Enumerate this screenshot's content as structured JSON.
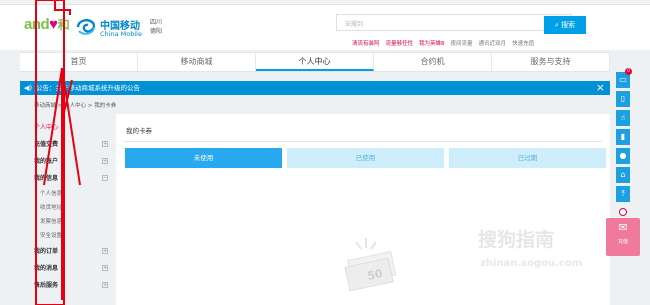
{
  "header": {
    "logo_and": "and",
    "logo_heart": "♥",
    "logo_he": "和",
    "cm_cn": "中国移动",
    "cm_en": "China Mobile",
    "region_province": "四川",
    "region_city": "德阳",
    "search_placeholder": "安耀到",
    "search_button": "搜索",
    "hot_links": [
      {
        "label": "清流有装阿",
        "color": "red"
      },
      {
        "label": "流量够任性",
        "color": "red"
      },
      {
        "label": "我为英雄8",
        "color": "red"
      },
      {
        "label": "夜间流量",
        "color": "grey"
      },
      {
        "label": "通讯近双月",
        "color": "grey"
      },
      {
        "label": "快速充值",
        "color": "grey"
      }
    ]
  },
  "nav": {
    "items": [
      "首页",
      "移动商城",
      "个人中心",
      "合约机",
      "服务与支持"
    ],
    "active_index": 2
  },
  "notice": {
    "icon": "speaker-icon",
    "text": "公告：关于移动商城系统升级的公告",
    "close": "×"
  },
  "breadcrumb": "移动商城 > 个人中心 > 我的卡券",
  "sidebar": {
    "title": "个人中心",
    "sections": [
      {
        "label": "充值交费",
        "toggle": "+"
      },
      {
        "label": "我的账户",
        "toggle": "+"
      },
      {
        "label": "我的信息",
        "toggle": "−",
        "children": [
          "个人信息",
          "收货地址",
          "发票信息",
          "安全设置"
        ]
      },
      {
        "label": "我的订单",
        "toggle": "+"
      },
      {
        "label": "我的消息",
        "toggle": "+"
      },
      {
        "label": "售后服务",
        "toggle": "+"
      }
    ]
  },
  "content": {
    "title": "我的卡券",
    "tabs": [
      "未使用",
      "已使用",
      "已过期"
    ],
    "active_tab": 0,
    "empty_coupon_value": "50"
  },
  "watermark": {
    "brand": "搜狗指南",
    "url": "zhinan.sogou.com"
  },
  "rightbar": {
    "cart_badge": "0",
    "icons": [
      "cart-icon",
      "phone-icon",
      "hand-icon",
      "sim-icon",
      "user-icon",
      "home-icon",
      "top-icon"
    ],
    "promo_label": "充值"
  },
  "colors": {
    "accent": "#00a0e9",
    "notice": "#0291d4",
    "tab_active": "#28a8ee",
    "tab_inactive": "#cdeefa",
    "brand_red": "#e4003a",
    "annotation": "#e60012"
  }
}
